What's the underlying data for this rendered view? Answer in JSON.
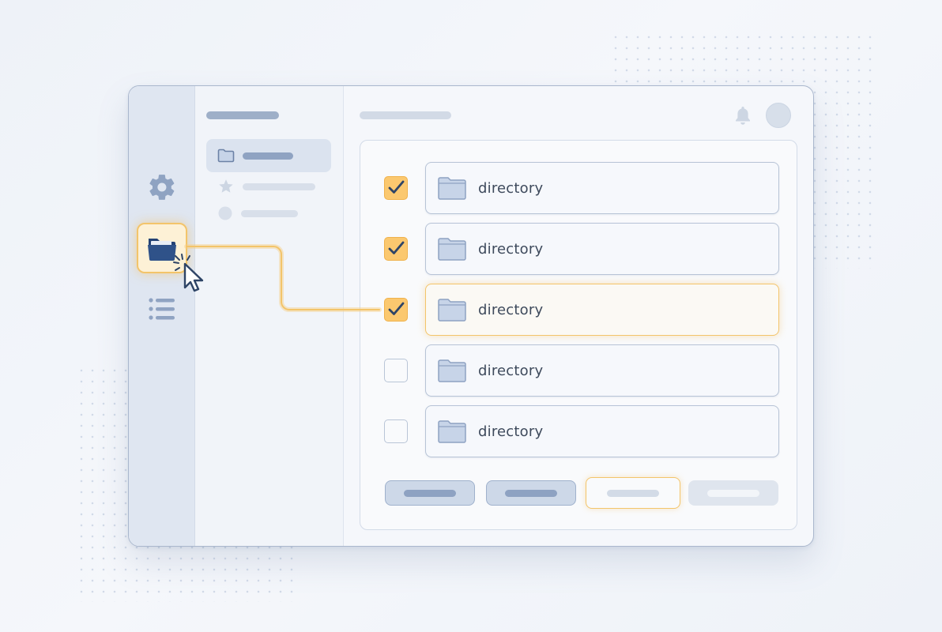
{
  "colors": {
    "accent": "#fbc86f",
    "accent_border": "#f3c46a",
    "folder_fill": "#c7d4e8",
    "folder_active": "#2f5289",
    "text": "#3e4a5c"
  },
  "rail": {
    "items": [
      {
        "icon": "gear-icon",
        "active": false
      },
      {
        "icon": "folder-icon",
        "active": true
      },
      {
        "icon": "list-icon",
        "active": false
      }
    ]
  },
  "nav": {
    "items": [
      {
        "icon": "folder-icon",
        "active": true
      },
      {
        "icon": "star-icon",
        "active": false
      },
      {
        "icon": "circle-icon",
        "active": false
      }
    ]
  },
  "header": {
    "icons": [
      "bell-icon",
      "avatar"
    ]
  },
  "directories": [
    {
      "label": "directory",
      "checked": true,
      "highlighted": false
    },
    {
      "label": "directory",
      "checked": true,
      "highlighted": false
    },
    {
      "label": "directory",
      "checked": true,
      "highlighted": true
    },
    {
      "label": "directory",
      "checked": false,
      "highlighted": false
    },
    {
      "label": "directory",
      "checked": false,
      "highlighted": false
    }
  ],
  "actions": [
    {
      "style": "primary"
    },
    {
      "style": "primary"
    },
    {
      "style": "highlighted"
    },
    {
      "style": "disabled"
    }
  ]
}
